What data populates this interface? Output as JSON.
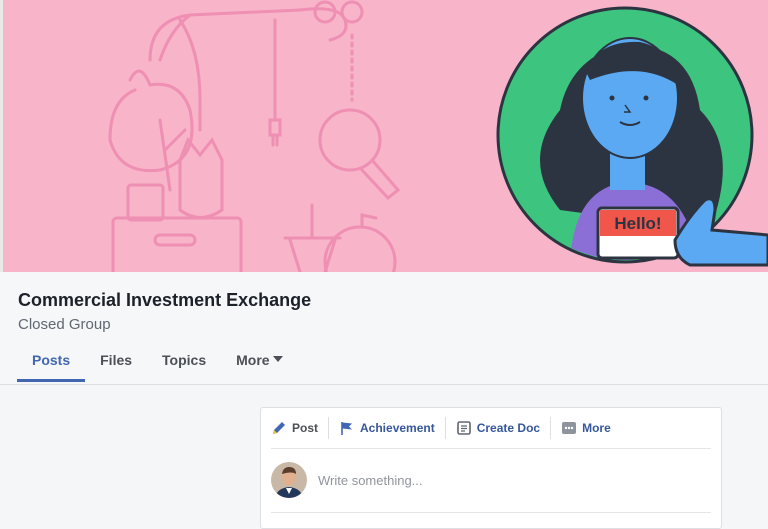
{
  "group": {
    "name": "Commercial Investment Exchange",
    "privacy": "Closed Group"
  },
  "cover": {
    "badge_text": "Hello!",
    "colors": {
      "background": "#f8b4c8",
      "circle": "#3dc47e",
      "skin": "#5aa9f2",
      "hair": "#2c3441",
      "shirt": "#8b6fd6",
      "badge": "#f0564a"
    }
  },
  "tabs": [
    {
      "label": "Posts",
      "active": true
    },
    {
      "label": "Files",
      "active": false
    },
    {
      "label": "Topics",
      "active": false
    },
    {
      "label": "More",
      "active": false
    }
  ],
  "composer": {
    "actions": [
      {
        "label": "Post",
        "icon": "pencil-icon"
      },
      {
        "label": "Achievement",
        "icon": "flag-icon"
      },
      {
        "label": "Create Doc",
        "icon": "document-icon"
      },
      {
        "label": "More",
        "icon": "more-dots-icon"
      }
    ],
    "placeholder": "Write something...",
    "avatar_icon": "user-avatar"
  },
  "colors": {
    "accent": "#4267b2",
    "link": "#365899"
  }
}
